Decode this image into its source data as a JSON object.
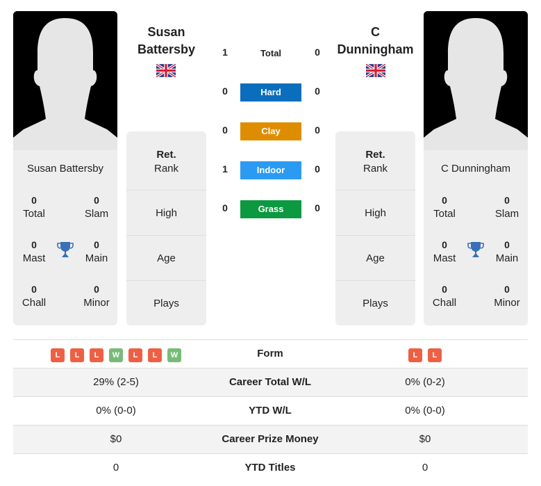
{
  "player1": {
    "name_heading_line1": "Susan",
    "name_heading_line2": "Battersby",
    "card_name": "Susan Battersby",
    "flag": "uk-flag-icon",
    "stats": [
      {
        "value": "0",
        "label": "Total"
      },
      {
        "value": "0",
        "label": "Slam"
      },
      {
        "value": "0",
        "label": "Mast"
      },
      {
        "value": "0",
        "label": "Main"
      },
      {
        "value": "0",
        "label": "Chall"
      },
      {
        "value": "0",
        "label": "Minor"
      }
    ],
    "info": {
      "rank_label_bold": "Ret.",
      "rank_label": "Rank",
      "high": "High",
      "age": "Age",
      "plays": "Plays"
    },
    "form": [
      "L",
      "L",
      "L",
      "W",
      "L",
      "L",
      "W"
    ]
  },
  "player2": {
    "name_heading_line1": "C",
    "name_heading_line2": "Dunningham",
    "card_name": "C Dunningham",
    "flag": "uk-flag-icon",
    "stats": [
      {
        "value": "0",
        "label": "Total"
      },
      {
        "value": "0",
        "label": "Slam"
      },
      {
        "value": "0",
        "label": "Mast"
      },
      {
        "value": "0",
        "label": "Main"
      },
      {
        "value": "0",
        "label": "Chall"
      },
      {
        "value": "0",
        "label": "Minor"
      }
    ],
    "info": {
      "rank_label_bold": "Ret.",
      "rank_label": "Rank",
      "high": "High",
      "age": "Age",
      "plays": "Plays"
    },
    "form": [
      "L",
      "L"
    ]
  },
  "h2h": {
    "total": {
      "label": "Total",
      "p1": "1",
      "p2": "0"
    },
    "surfaces": [
      {
        "label": "Hard",
        "p1": "0",
        "p2": "0",
        "color": "#0a6ebd"
      },
      {
        "label": "Clay",
        "p1": "0",
        "p2": "0",
        "color": "#df8d00"
      },
      {
        "label": "Indoor",
        "p1": "1",
        "p2": "0",
        "color": "#2b9af3"
      },
      {
        "label": "Grass",
        "p1": "0",
        "p2": "0",
        "color": "#0c9940"
      }
    ]
  },
  "colors": {
    "win": "#77bb77",
    "loss": "#ee6044",
    "trophy": "#3b6fb6"
  },
  "comparison": {
    "form_label": "Form",
    "rows": [
      {
        "label": "Career Total W/L",
        "p1": "29% (2-5)",
        "p2": "0% (0-2)"
      },
      {
        "label": "YTD W/L",
        "p1": "0% (0-0)",
        "p2": "0% (0-0)"
      },
      {
        "label": "Career Prize Money",
        "p1": "$0",
        "p2": "$0"
      },
      {
        "label": "YTD Titles",
        "p1": "0",
        "p2": "0"
      }
    ]
  }
}
